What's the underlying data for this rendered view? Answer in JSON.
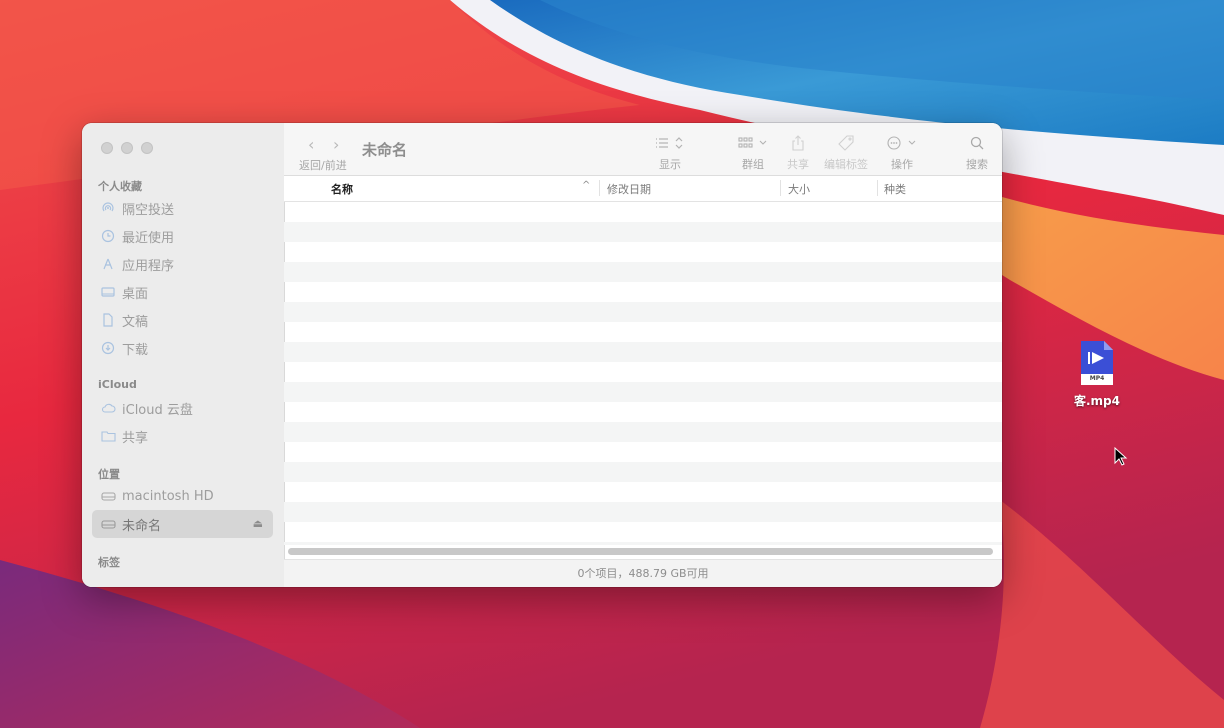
{
  "window": {
    "title": "未命名",
    "nav_label": "返回/前进",
    "toolbar": {
      "view_label": "显示",
      "group_label": "群组",
      "share_label": "共享",
      "tags_label": "编辑标签",
      "action_label": "操作",
      "search_label": "搜索"
    }
  },
  "sidebar": {
    "favorites_title": "个人收藏",
    "favorites": [
      {
        "label": "隔空投送",
        "icon": "airdrop-icon"
      },
      {
        "label": "最近使用",
        "icon": "clock-icon"
      },
      {
        "label": "应用程序",
        "icon": "apps-icon"
      },
      {
        "label": "桌面",
        "icon": "desktop-icon"
      },
      {
        "label": "文稿",
        "icon": "document-icon"
      },
      {
        "label": "下载",
        "icon": "download-icon"
      }
    ],
    "icloud_title": "iCloud",
    "icloud": [
      {
        "label": "iCloud 云盘",
        "icon": "cloud-icon"
      },
      {
        "label": "共享",
        "icon": "shared-folder-icon"
      }
    ],
    "locations_title": "位置",
    "locations": [
      {
        "label": "macintosh HD",
        "icon": "disk-icon"
      },
      {
        "label": "未命名",
        "icon": "disk-icon",
        "selected": true
      }
    ],
    "tags_title": "标签"
  },
  "columns": {
    "name": "名称",
    "date": "修改日期",
    "size": "大小",
    "kind": "种类"
  },
  "status": "0个项目，488.79 GB可用",
  "desktop": {
    "file_label": "客.mp4",
    "file_badge": "MP4"
  }
}
